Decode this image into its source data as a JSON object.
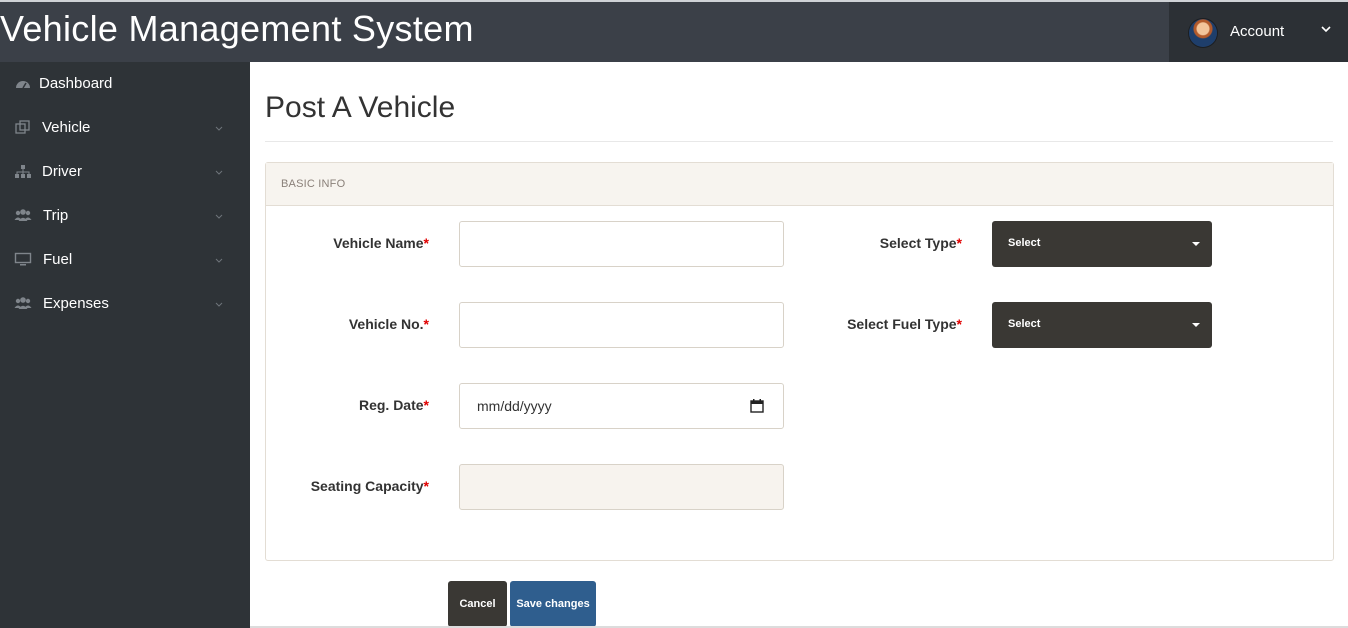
{
  "header": {
    "title": "Vehicle Management System",
    "account_label": "Account"
  },
  "sidebar": {
    "items": [
      {
        "label": "Dashboard",
        "icon": "dashboard-icon",
        "has_submenu": false
      },
      {
        "label": "Vehicle",
        "icon": "vehicle-icon",
        "has_submenu": true
      },
      {
        "label": "Driver",
        "icon": "sitemap-icon",
        "has_submenu": true
      },
      {
        "label": "Trip",
        "icon": "users-icon",
        "has_submenu": true
      },
      {
        "label": "Fuel",
        "icon": "monitor-icon",
        "has_submenu": true
      },
      {
        "label": "Expenses",
        "icon": "users-icon",
        "has_submenu": true
      }
    ]
  },
  "main": {
    "page_title": "Post A Vehicle",
    "panel_title": "BASIC INFO",
    "required_marker": "*",
    "fields": {
      "vehicle_name": {
        "label": "Vehicle Name",
        "value": ""
      },
      "vehicle_no": {
        "label": "Vehicle No.",
        "value": ""
      },
      "reg_date": {
        "label": "Reg. Date",
        "value": "",
        "placeholder": "mm/dd/yyyy"
      },
      "seating_capacity": {
        "label": "Seating Capacity",
        "value": ""
      },
      "select_type": {
        "label": "Select Type",
        "selected": "Select"
      },
      "select_fuel_type": {
        "label": "Select Fuel Type",
        "selected": "Select"
      }
    },
    "buttons": {
      "cancel": "Cancel",
      "save": "Save changes"
    }
  },
  "colors": {
    "topbar": "#3b4048",
    "account_bg": "#2c3035",
    "sidebar": "#2e3337",
    "select_bg": "#3a3834",
    "save_button": "#2f5e8e",
    "required": "#e00000",
    "panel_header": "#f7f4ef"
  }
}
